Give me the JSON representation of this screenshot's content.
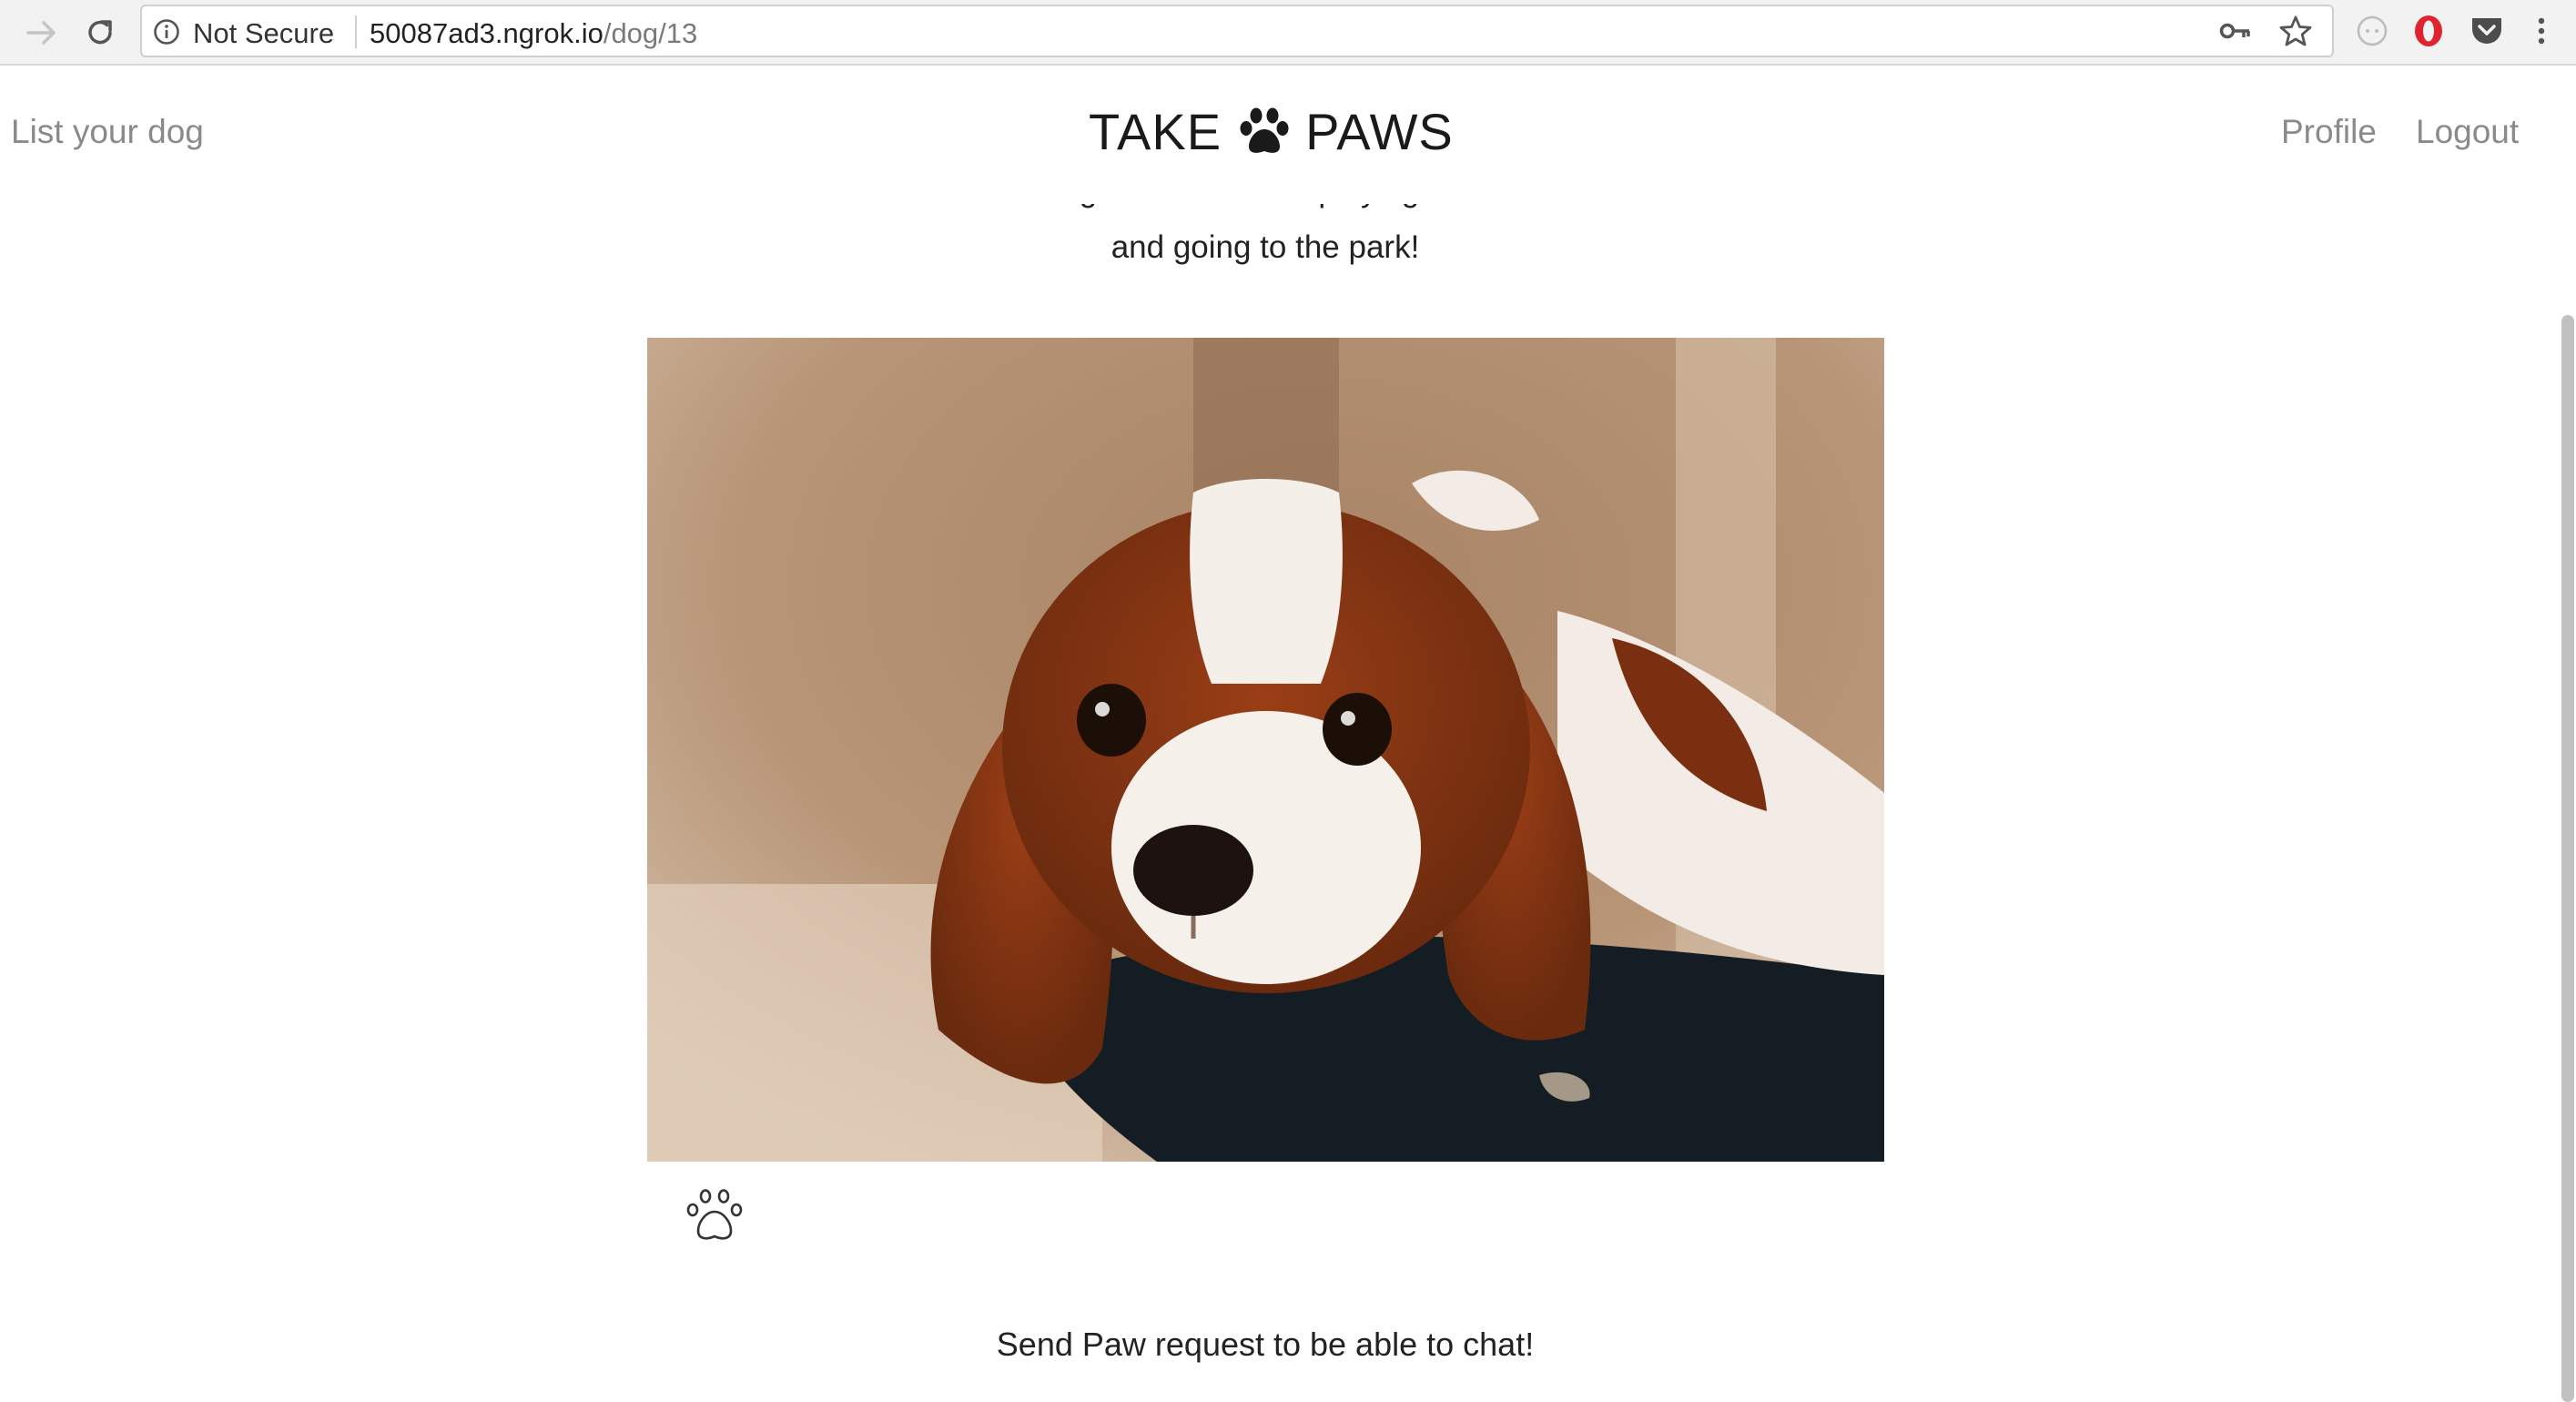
{
  "browser": {
    "security_label": "Not Secure",
    "url_host": "50087ad3.ngrok.io",
    "url_path": "/dog/13",
    "icons": [
      "forward-arrow-icon",
      "reload-icon",
      "info-icon",
      "key-icon",
      "star-icon",
      "extension-icon",
      "opera-icon",
      "pocket-icon",
      "menu-dots-icon"
    ]
  },
  "nav": {
    "list_dog": "List your dog",
    "logo_left": "TAKE",
    "logo_right": "PAWS",
    "profile": "Profile",
    "logout": "Logout"
  },
  "dog": {
    "description_line1": "Best dog ever! He loves playing with balls",
    "description_line2": "and going to the park!",
    "photo_alt": "Cavalier King Charles Spaniel puppy"
  },
  "actions": {
    "paw_icon": "paw-outline-icon",
    "cta_text": "Send Paw request to be able to chat!"
  },
  "colors": {
    "nav_text": "#8a8a8a",
    "body_text": "#222222",
    "logo_text": "#1a1a1a"
  }
}
